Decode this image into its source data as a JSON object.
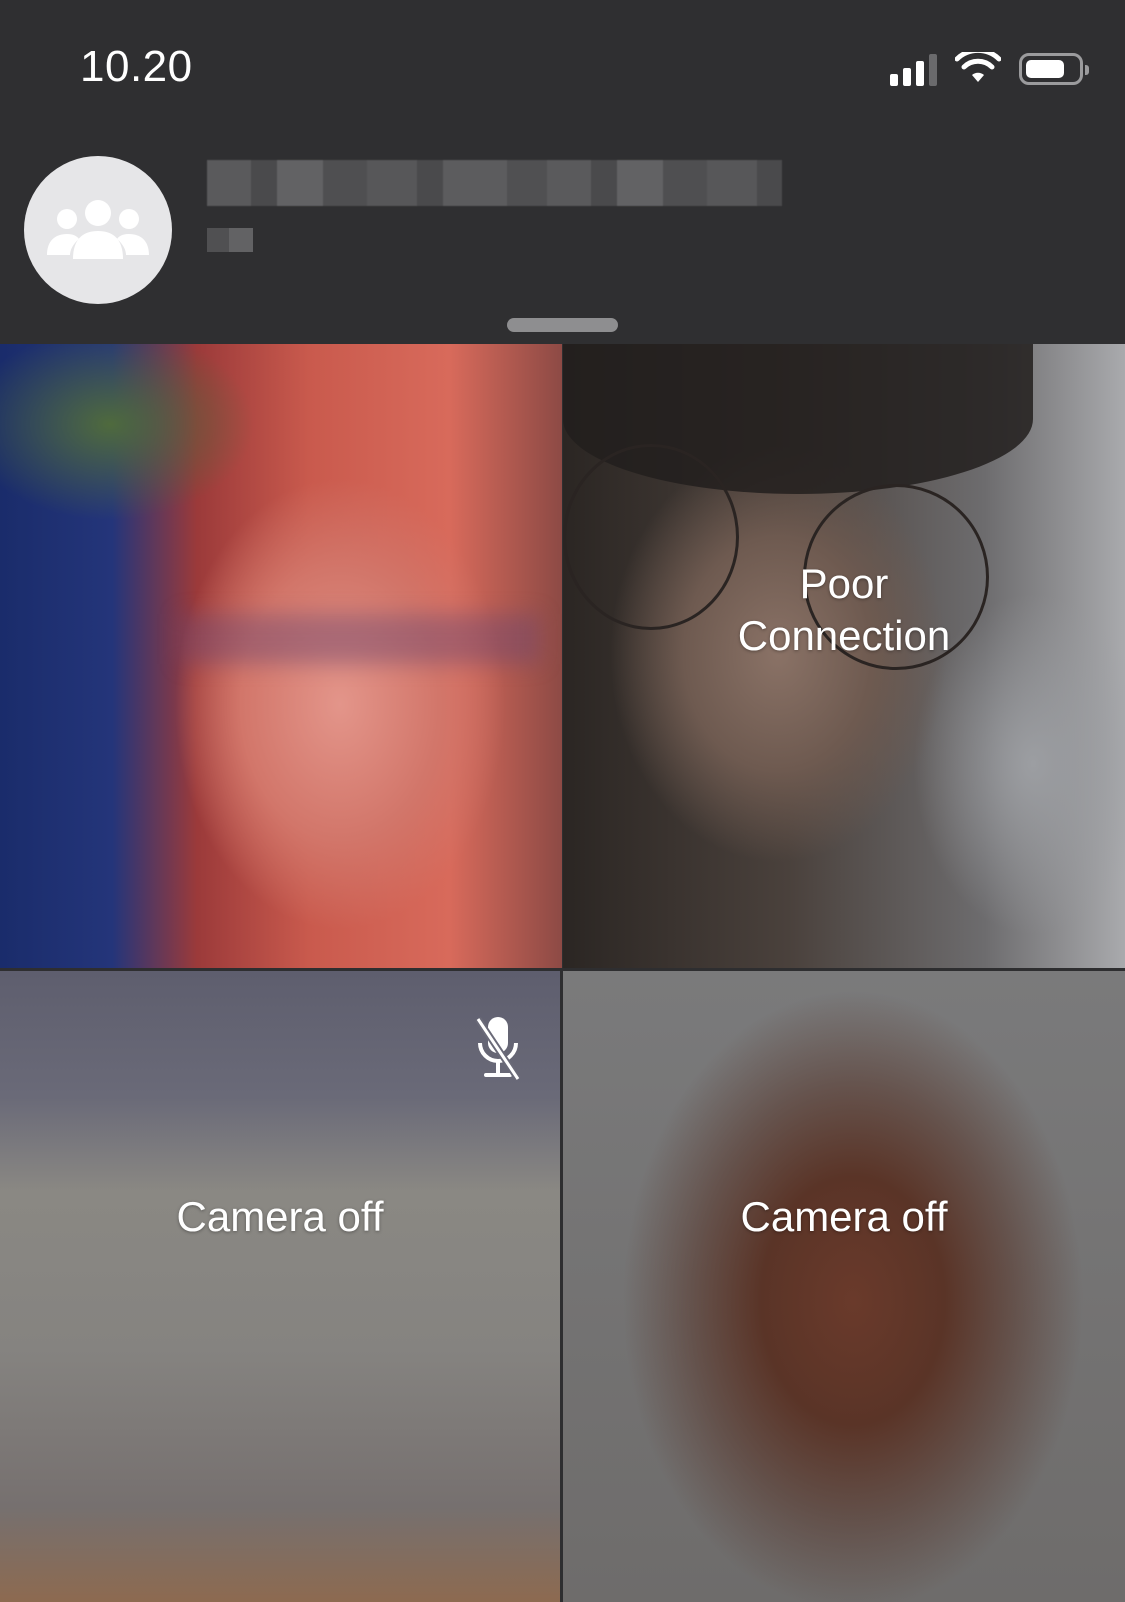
{
  "status_bar": {
    "time": "10.20",
    "icons": [
      "cellular-signal-icon",
      "wifi-icon",
      "battery-icon"
    ],
    "battery_level": 0.75
  },
  "call_header": {
    "avatar_icon": "group-icon"
  },
  "participants": [
    {
      "video": "on",
      "label": ""
    },
    {
      "video": "on",
      "label": "Poor Connection"
    },
    {
      "video": "off",
      "label": "Camera off",
      "muted_icon": "microphone-muted-icon"
    },
    {
      "video": "off",
      "label": "Camera off"
    }
  ],
  "colors": {
    "header_bg": "#2f2f31",
    "avatar_bg": "#e6e6e8",
    "text": "#ffffff"
  }
}
